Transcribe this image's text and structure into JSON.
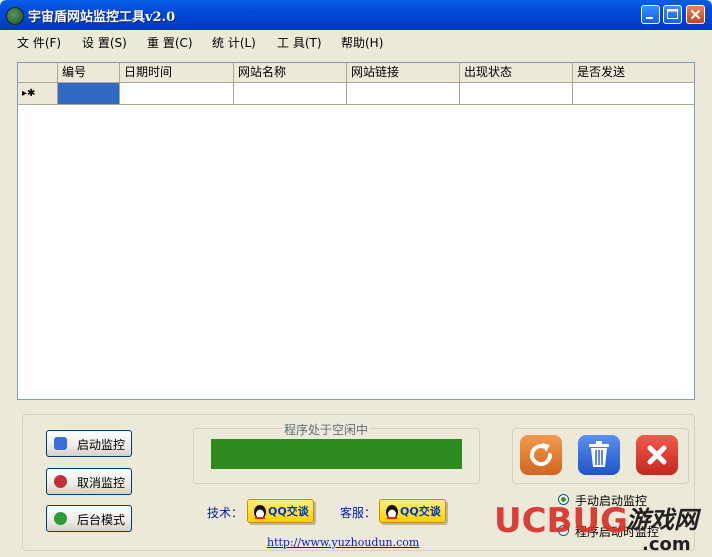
{
  "window": {
    "title": "宇宙盾网站监控工具v2.0"
  },
  "menu": [
    {
      "label": "文 件(F)"
    },
    {
      "label": "设 置(S)"
    },
    {
      "label": "重 置(C)"
    },
    {
      "label": "统 计(L)"
    },
    {
      "label": "工 具(T)"
    },
    {
      "label": "帮助(H)"
    }
  ],
  "grid": {
    "columns": [
      "编号",
      "日期时间",
      "网站名称",
      "网站链接",
      "出现状态",
      "是否发送"
    ],
    "row_indicator": "▸✱"
  },
  "buttons": {
    "start": "启动监控",
    "cancel": "取消监控",
    "background": "后台模式"
  },
  "status": {
    "label": "程序处于空闲中",
    "progress": 1.0,
    "progress_color": "#2e8b1e"
  },
  "contact": {
    "tech_label": "技术：",
    "service_label": "客服：",
    "qq_text": "QQ交谈"
  },
  "footer": {
    "url": "http://www.yuzhoudun.com"
  },
  "radios": [
    {
      "label": "手动启动监控",
      "checked": true
    },
    {
      "label": "程序启动时监控",
      "checked": false
    }
  ],
  "watermark": {
    "brand": "UCBUG",
    "cn": "游戏网",
    "tld": ".com"
  },
  "colors": {
    "accent": "#316ac5",
    "refresh": "#e27b2e",
    "delete": "#2c63d6",
    "close": "#d63c34"
  }
}
